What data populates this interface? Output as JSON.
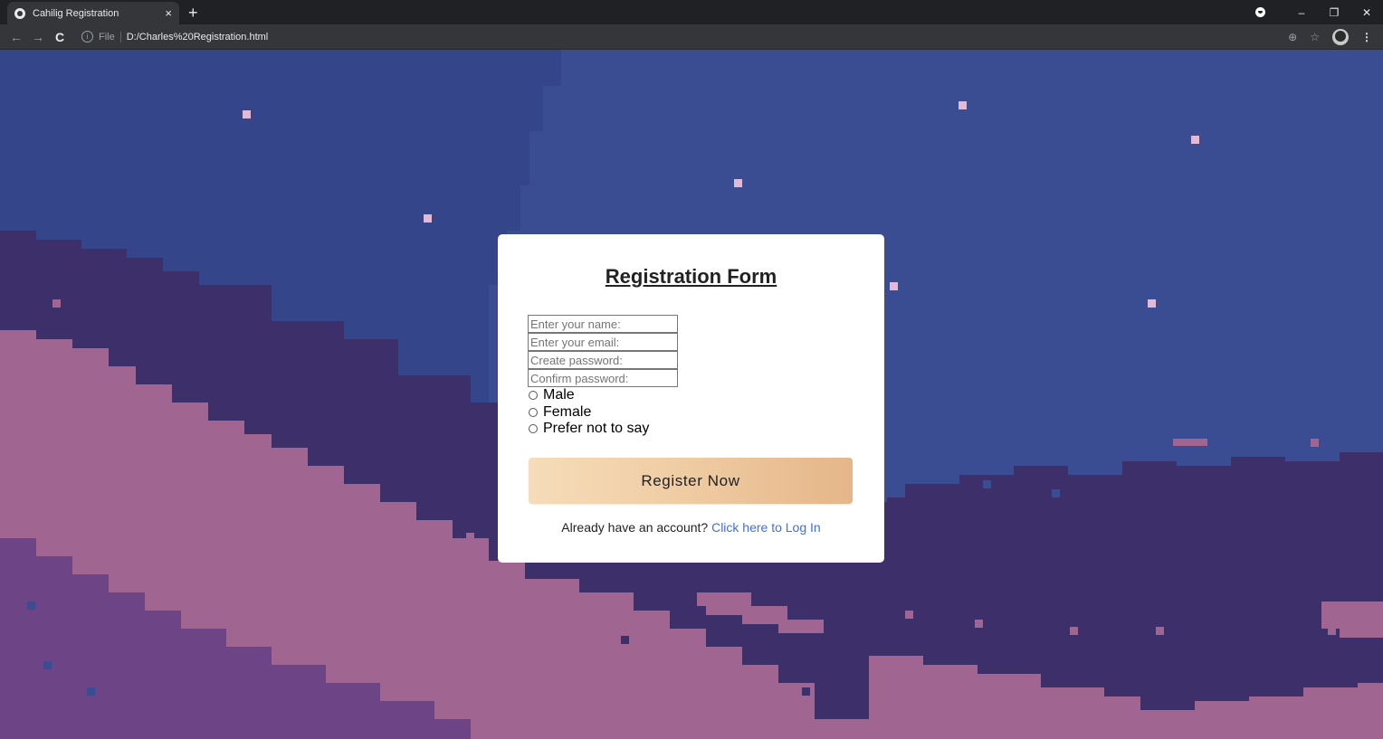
{
  "browser": {
    "tab_title": "Cahilig Registration",
    "tab_close": "×",
    "new_tab": "+",
    "url_scheme": "File",
    "url": "D:/Charles%20Registration.html",
    "window_controls": {
      "minimize": "–",
      "restore": "❐",
      "close": "✕"
    },
    "nav": {
      "back": "←",
      "forward": "→",
      "reload": "C"
    },
    "icons": [
      "info-icon",
      "zoom-icon",
      "star-icon",
      "profile-avatar",
      "menu-icon"
    ]
  },
  "form": {
    "title": "Registration Form",
    "name_placeholder": "Enter your name:",
    "email_placeholder": "Enter your email:",
    "password_placeholder": "Create password:",
    "confirm_placeholder": "Confirm password:",
    "gender_options": [
      "Male",
      "Female",
      "Prefer not to say"
    ],
    "submit_label": "Register Now",
    "login_prompt": "Already have an account?",
    "login_link": "Click here to Log In"
  },
  "colors": {
    "sky": "#3a4d92",
    "mountain_dark": "#3d2f6a",
    "mountain_pink": "#a06590",
    "mountain_purple": "#6d4486",
    "button_start": "#f6dcba",
    "button_end": "#e5b689",
    "link": "#3f6fe3"
  }
}
